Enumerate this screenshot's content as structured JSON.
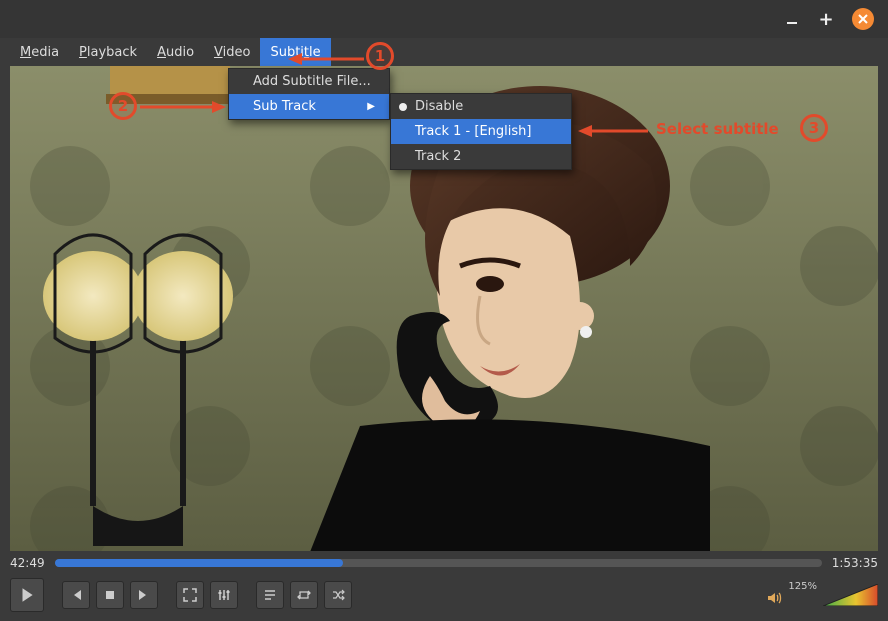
{
  "titlebar": {},
  "menubar": {
    "items": [
      {
        "pre": "",
        "acc": "M",
        "post": "edia"
      },
      {
        "pre": "",
        "acc": "P",
        "post": "layback"
      },
      {
        "pre": "",
        "acc": "A",
        "post": "udio"
      },
      {
        "pre": "",
        "acc": "V",
        "post": "ideo"
      },
      {
        "pre": "Subti",
        "acc": "t",
        "post": "le"
      }
    ]
  },
  "subtitle_menu": {
    "add_file": "Add Subtitle File...",
    "sub_track": "Sub Track"
  },
  "subtrack_menu": {
    "disable": "Disable",
    "track1": "Track 1 - [English]",
    "track2": "Track 2"
  },
  "seek": {
    "elapsed": "42:49",
    "total": "1:53:35",
    "progress_pct": 37.6
  },
  "volume": {
    "label": "125%"
  },
  "annotations": {
    "n1": "1",
    "n2": "2",
    "n3": "3",
    "select_subtitle": "Select subtitle"
  }
}
